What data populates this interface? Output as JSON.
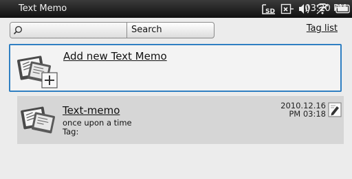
{
  "statusbar": {
    "title": "Text Memo",
    "time": "03:20 PM",
    "icons": [
      "sd-card-icon",
      "usb-icon",
      "volume-icon",
      "wifi-icon",
      "battery-icon"
    ]
  },
  "search": {
    "placeholder": "",
    "value": "",
    "button_label": "Search",
    "tag_list_label": "Tag list"
  },
  "add_memo": {
    "label": "Add new Text Memo",
    "icon": "memo-add-icon"
  },
  "memos": [
    {
      "title": "Text-memo",
      "body": "once upon a time",
      "tag": "Tag:",
      "date": "2010.12.16",
      "time": "PM 03:18",
      "icon": "memo-icon"
    }
  ],
  "colors": {
    "statusbar": "#1c1c1c",
    "background": "#ececec",
    "selection_border": "#2f7fc2",
    "memo_row": "#d6d6d6"
  }
}
